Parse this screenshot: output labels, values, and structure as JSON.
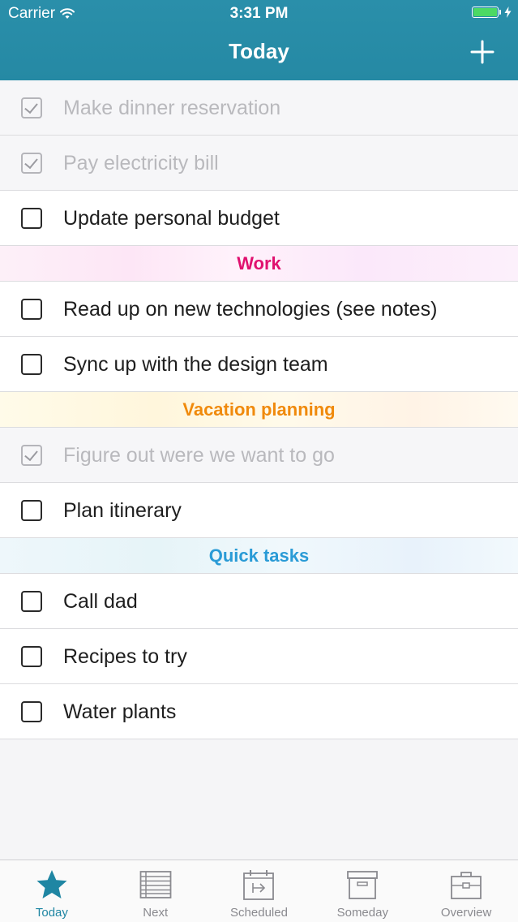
{
  "status_bar": {
    "carrier": "Carrier",
    "time": "3:31 PM",
    "battery_level": 1.0,
    "battery_color": "#4cd964"
  },
  "nav": {
    "title": "Today",
    "add_icon": "plus-icon",
    "bar_color": "#2a8faa"
  },
  "tasks_top": [
    {
      "label": "Make dinner reservation",
      "done": true
    },
    {
      "label": "Pay electricity bill",
      "done": true
    },
    {
      "label": "Update personal budget",
      "done": false
    }
  ],
  "sections": [
    {
      "title": "Work",
      "color": "#e0116f",
      "tasks": [
        {
          "label": "Read up on new technologies (see notes)",
          "done": false
        },
        {
          "label": "Sync up with the design team",
          "done": false
        }
      ]
    },
    {
      "title": "Vacation planning",
      "color": "#f08a0c",
      "tasks": [
        {
          "label": "Figure out were we want to go",
          "done": true
        },
        {
          "label": "Plan itinerary",
          "done": false
        }
      ]
    },
    {
      "title": "Quick tasks",
      "color": "#2a9bd6",
      "tasks": [
        {
          "label": "Call dad",
          "done": false
        },
        {
          "label": "Recipes to try",
          "done": false
        },
        {
          "label": "Water plants",
          "done": false
        }
      ]
    }
  ],
  "tab_bar": {
    "active_color": "#1f86a3",
    "tabs": [
      {
        "label": "Today",
        "icon": "star-icon",
        "active": true
      },
      {
        "label": "Next",
        "icon": "list-icon",
        "active": false
      },
      {
        "label": "Scheduled",
        "icon": "calendar-icon",
        "active": false
      },
      {
        "label": "Someday",
        "icon": "archive-box-icon",
        "active": false
      },
      {
        "label": "Overview",
        "icon": "briefcase-icon",
        "active": false
      }
    ]
  }
}
